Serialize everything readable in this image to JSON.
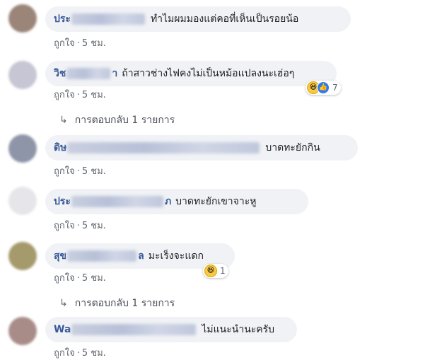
{
  "meta_like": "ถูกใจ",
  "meta_dot": "·",
  "meta_time": "5 ชม.",
  "reply_arrow": "↳",
  "comments": [
    {
      "name_start": "ประ",
      "name_end": "",
      "text": "ทำไมผมมองแต่คอที่เห็นเป็นรอยน้อ",
      "avatar_color": "#9b8478"
    },
    {
      "name_start": "วิช",
      "name_end": "า",
      "text": "ถ้าสาวช่างไฟคงไม่เป็นหม้อแปลงนะเฮ่อๆ",
      "avatar_color": "#c6c6d4",
      "reaction_count": "7",
      "reaction_icons": [
        "haha-icon",
        "like-icon"
      ]
    },
    {
      "name_start": "ดิษ",
      "name_end": "",
      "text": "บาดทะยักกิน",
      "avatar_color": "#8e95a8"
    },
    {
      "name_start": "ประ",
      "name_end": "ภ",
      "text": "บาดทะยักเขาจาะหู",
      "avatar_color": "#e6e6ea"
    },
    {
      "name_start": "สุข",
      "name_end": "ล",
      "text": "มะเร็งจะแดก",
      "avatar_color": "#a49a6c",
      "reaction_count": "1",
      "reaction_icons": [
        "haha-icon"
      ]
    },
    {
      "name_start": "Wa",
      "name_end": "",
      "text": "ไม่แนะนำนะครับ",
      "avatar_color": "#a88c88"
    }
  ],
  "replies": [
    {
      "label": "การตอบกลับ 1 รายการ"
    },
    {
      "label": "การตอบกลับ 1 รายการ"
    }
  ]
}
